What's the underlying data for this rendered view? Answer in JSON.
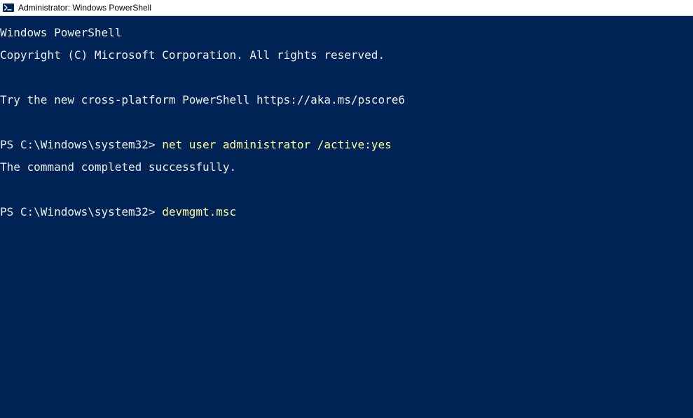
{
  "titlebar": {
    "title": "Administrator: Windows PowerShell"
  },
  "terminal": {
    "header1": "Windows PowerShell",
    "header2": "Copyright (C) Microsoft Corporation. All rights reserved.",
    "tip": "Try the new cross-platform PowerShell https://aka.ms/pscore6",
    "prompt1": "PS C:\\Windows\\system32> ",
    "cmd1": "net user administrator /active:yes",
    "output1": "The command completed successfully.",
    "prompt2": "PS C:\\Windows\\system32> ",
    "cmd2": "devmgmt.msc"
  }
}
